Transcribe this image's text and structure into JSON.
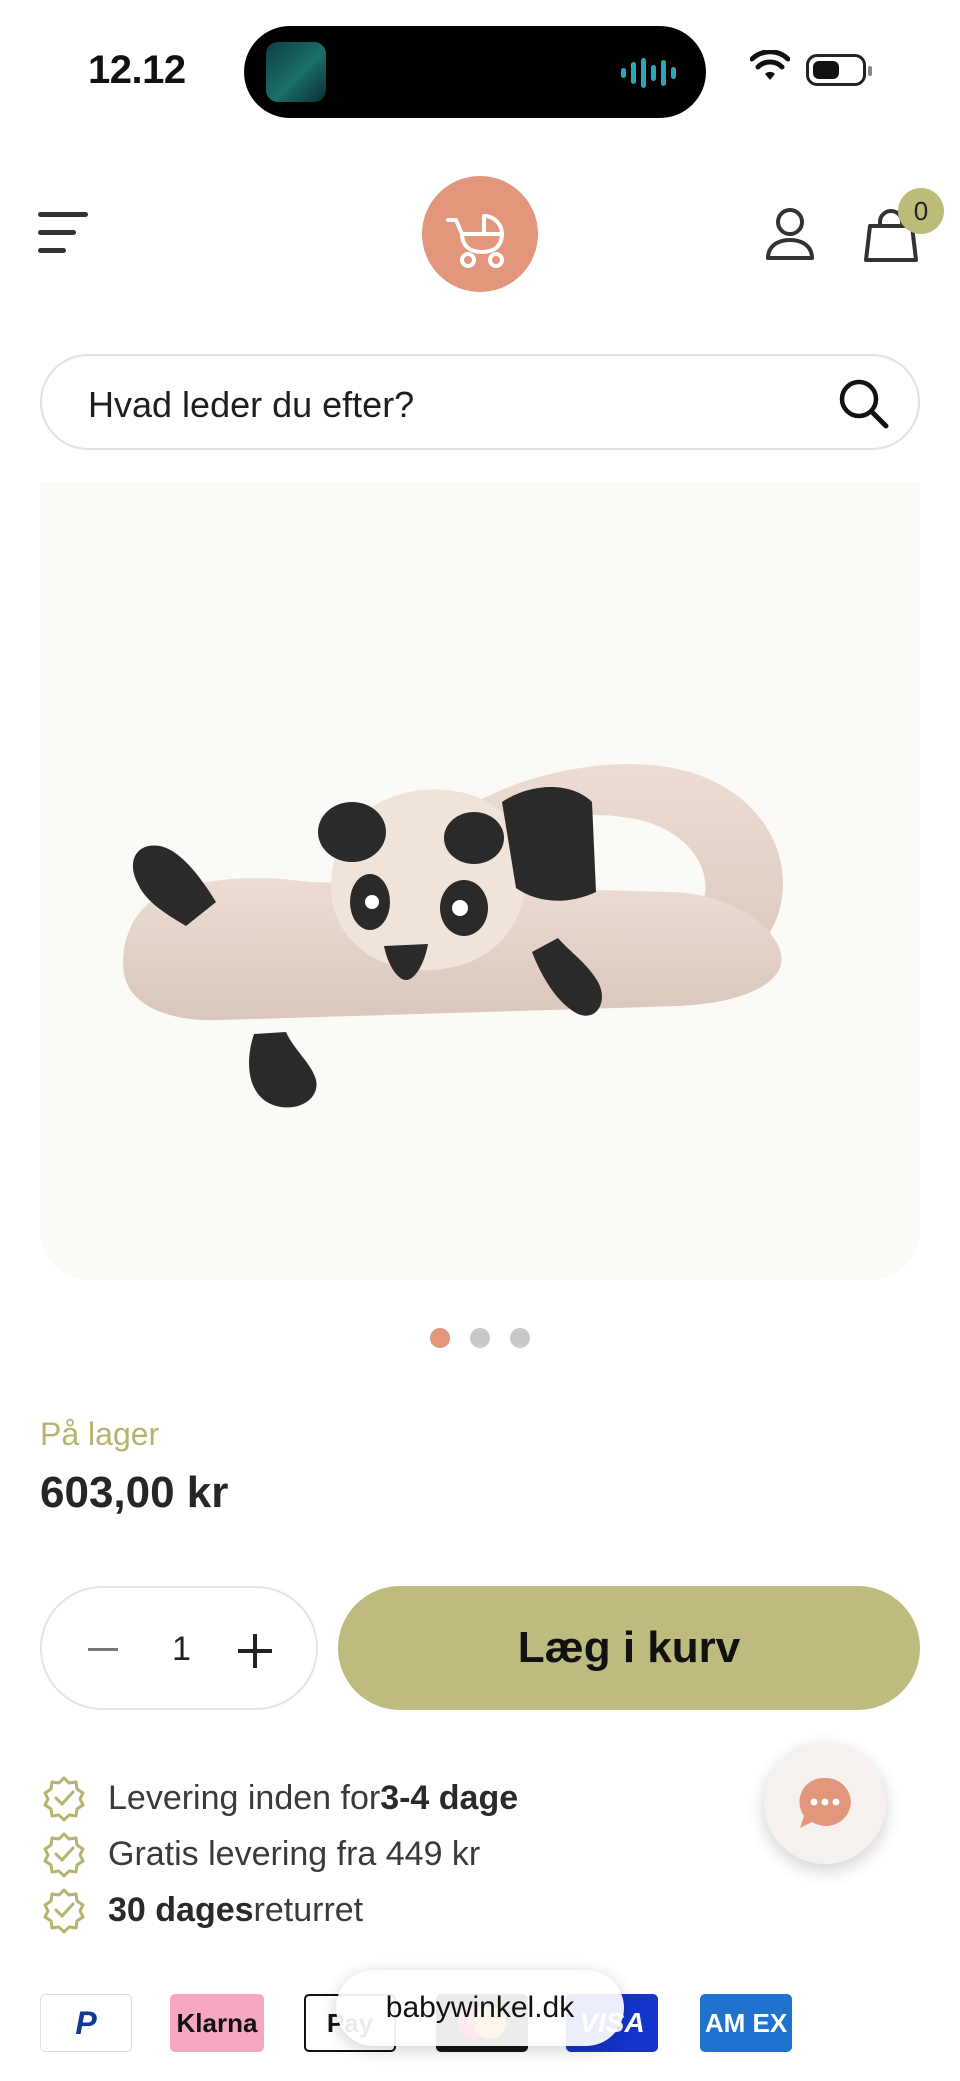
{
  "status_bar": {
    "time": "12.12"
  },
  "header": {
    "menu_icon": "hamburger-menu-icon",
    "logo_icon": "baby-carriage-icon",
    "account_icon": "user-icon",
    "cart_icon": "shopping-bag-icon",
    "cart_count": "0"
  },
  "search": {
    "placeholder": "Hvad leder du efter?",
    "icon": "search-icon"
  },
  "gallery": {
    "slides": 3,
    "active_index": 0
  },
  "product": {
    "stock_status": "På lager",
    "price": "603,00 kr",
    "quantity": "1",
    "add_to_cart_label": "Læg i kurv"
  },
  "usps": [
    {
      "pre": "Levering inden for ",
      "bold": "3-4 dage",
      "post": ""
    },
    {
      "pre": "Gratis levering fra 449 kr",
      "bold": "",
      "post": ""
    },
    {
      "pre": "",
      "bold": "30 dages",
      "post": " returret"
    }
  ],
  "payments": {
    "paypal": "P",
    "klarna": "Klarna",
    "apple": "Pay",
    "visa": "VISA",
    "amex": "AM EX"
  },
  "browser": {
    "url": "babywinkel.dk"
  },
  "colors": {
    "accent_peach": "#e2967c",
    "accent_olive": "#bdbc7e",
    "stock_green": "#b5b46f"
  }
}
